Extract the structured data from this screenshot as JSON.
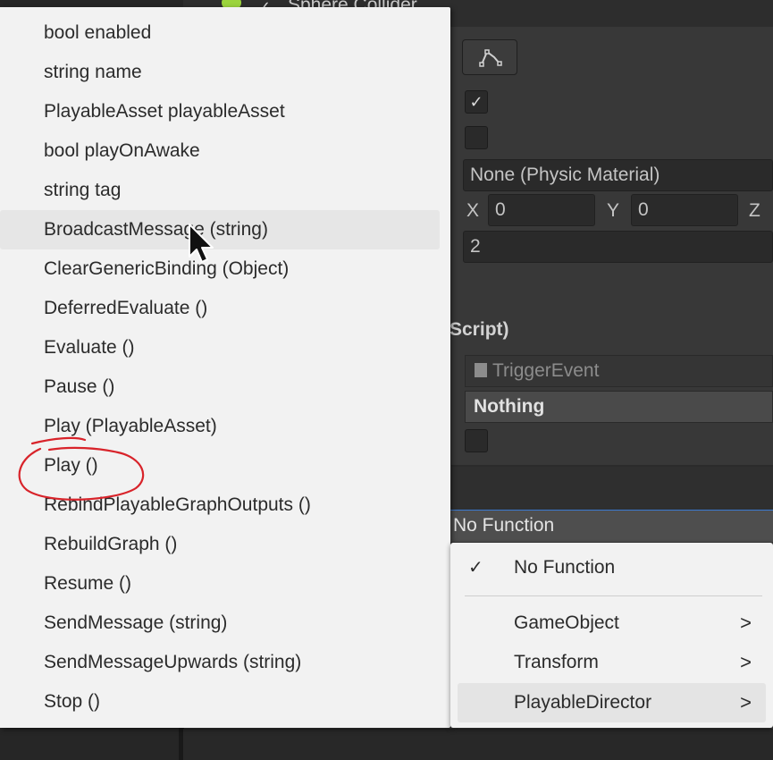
{
  "inspector": {
    "component_title": "Sphere Collider",
    "physic_material": "None (Physic Material)",
    "center_x_label": "X",
    "center_x_value": "0",
    "center_y_label": "Y",
    "center_y_value": "0",
    "center_z_label": "Z",
    "radius_value": "2",
    "script_section_title": "Script)",
    "script_field": "TriggerEvent",
    "event_mask_value": "Nothing",
    "function_dropdown_value": "No Function"
  },
  "function_menu": {
    "items": [
      {
        "label": "No Function",
        "checked": true
      },
      {
        "label": "GameObject",
        "submenu": true
      },
      {
        "label": "Transform",
        "submenu": true
      },
      {
        "label": "PlayableDirector",
        "submenu": true,
        "highlighted": true
      }
    ],
    "check_glyph": "✓",
    "arrow_glyph": ">"
  },
  "playable_director_menu": {
    "items": [
      "bool enabled",
      "string name",
      "PlayableAsset playableAsset",
      "bool playOnAwake",
      "string tag",
      "BroadcastMessage (string)",
      "ClearGenericBinding (Object)",
      "DeferredEvaluate ()",
      "Evaluate ()",
      "Pause ()",
      "Play (PlayableAsset)",
      "Play ()",
      "RebindPlayableGraphOutputs ()",
      "RebuildGraph ()",
      "Resume ()",
      "SendMessage (string)",
      "SendMessageUpwards (string)",
      "Stop ()"
    ],
    "hovered_item": "BroadcastMessage (string)",
    "circled_item": "Play ()"
  },
  "colors": {
    "menu_bg": "#f2f2f2",
    "inspector_bg": "#383838",
    "annotation_red": "#d8232a",
    "focus_blue": "#3b7ad1"
  },
  "icons": [
    "edit-collider-icon",
    "checkmark-icon",
    "script-icon",
    "chevron-right-icon",
    "mouse-cursor-icon"
  ]
}
